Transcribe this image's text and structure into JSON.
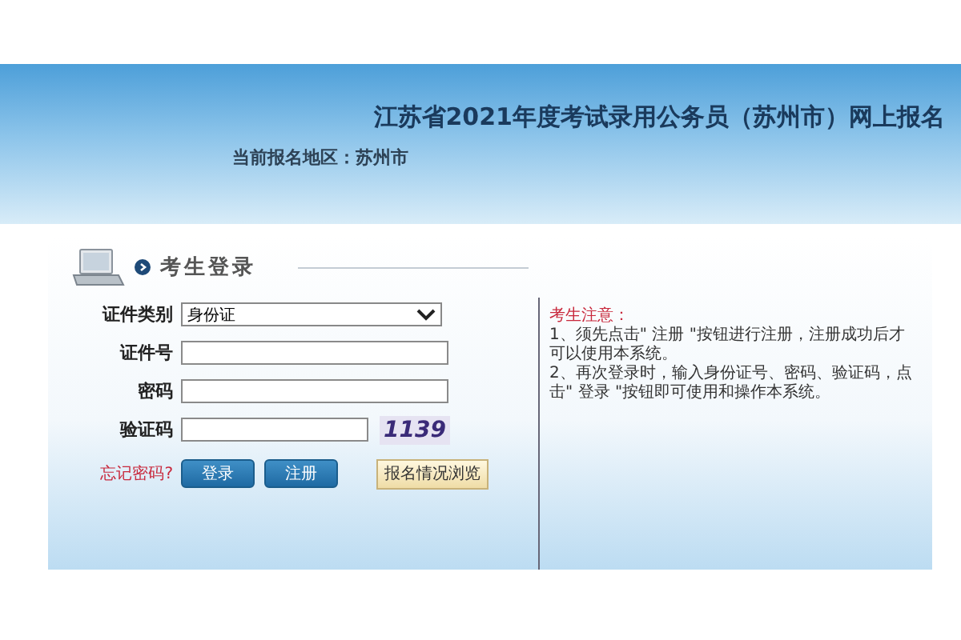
{
  "header": {
    "title": "江苏省2021年度考试录用公务员（苏州市）网上报名",
    "region_label": "当前报名地区：苏州市"
  },
  "login": {
    "heading": "考生登录",
    "fields": [
      {
        "kind": "select",
        "label": "证件类别",
        "value": "身份证"
      },
      {
        "kind": "text",
        "label": "证件号"
      },
      {
        "kind": "password",
        "label": "密码"
      },
      {
        "kind": "captcha",
        "label": "验证码",
        "captcha": "1139"
      }
    ],
    "forgot_link": "忘记密码?",
    "buttons": [
      "登录",
      "注册"
    ],
    "browse_button": "报名情况浏览"
  },
  "notice": {
    "title": "考生注意：",
    "items": [
      "1、须先点击\" 注册 \"按钮进行注册，注册成功后才可以使用本系统。",
      "2、再次登录时，输入身份证号、密码、验证码，点击\" 登录 \"按钮即可使用和操作本系统。"
    ]
  }
}
